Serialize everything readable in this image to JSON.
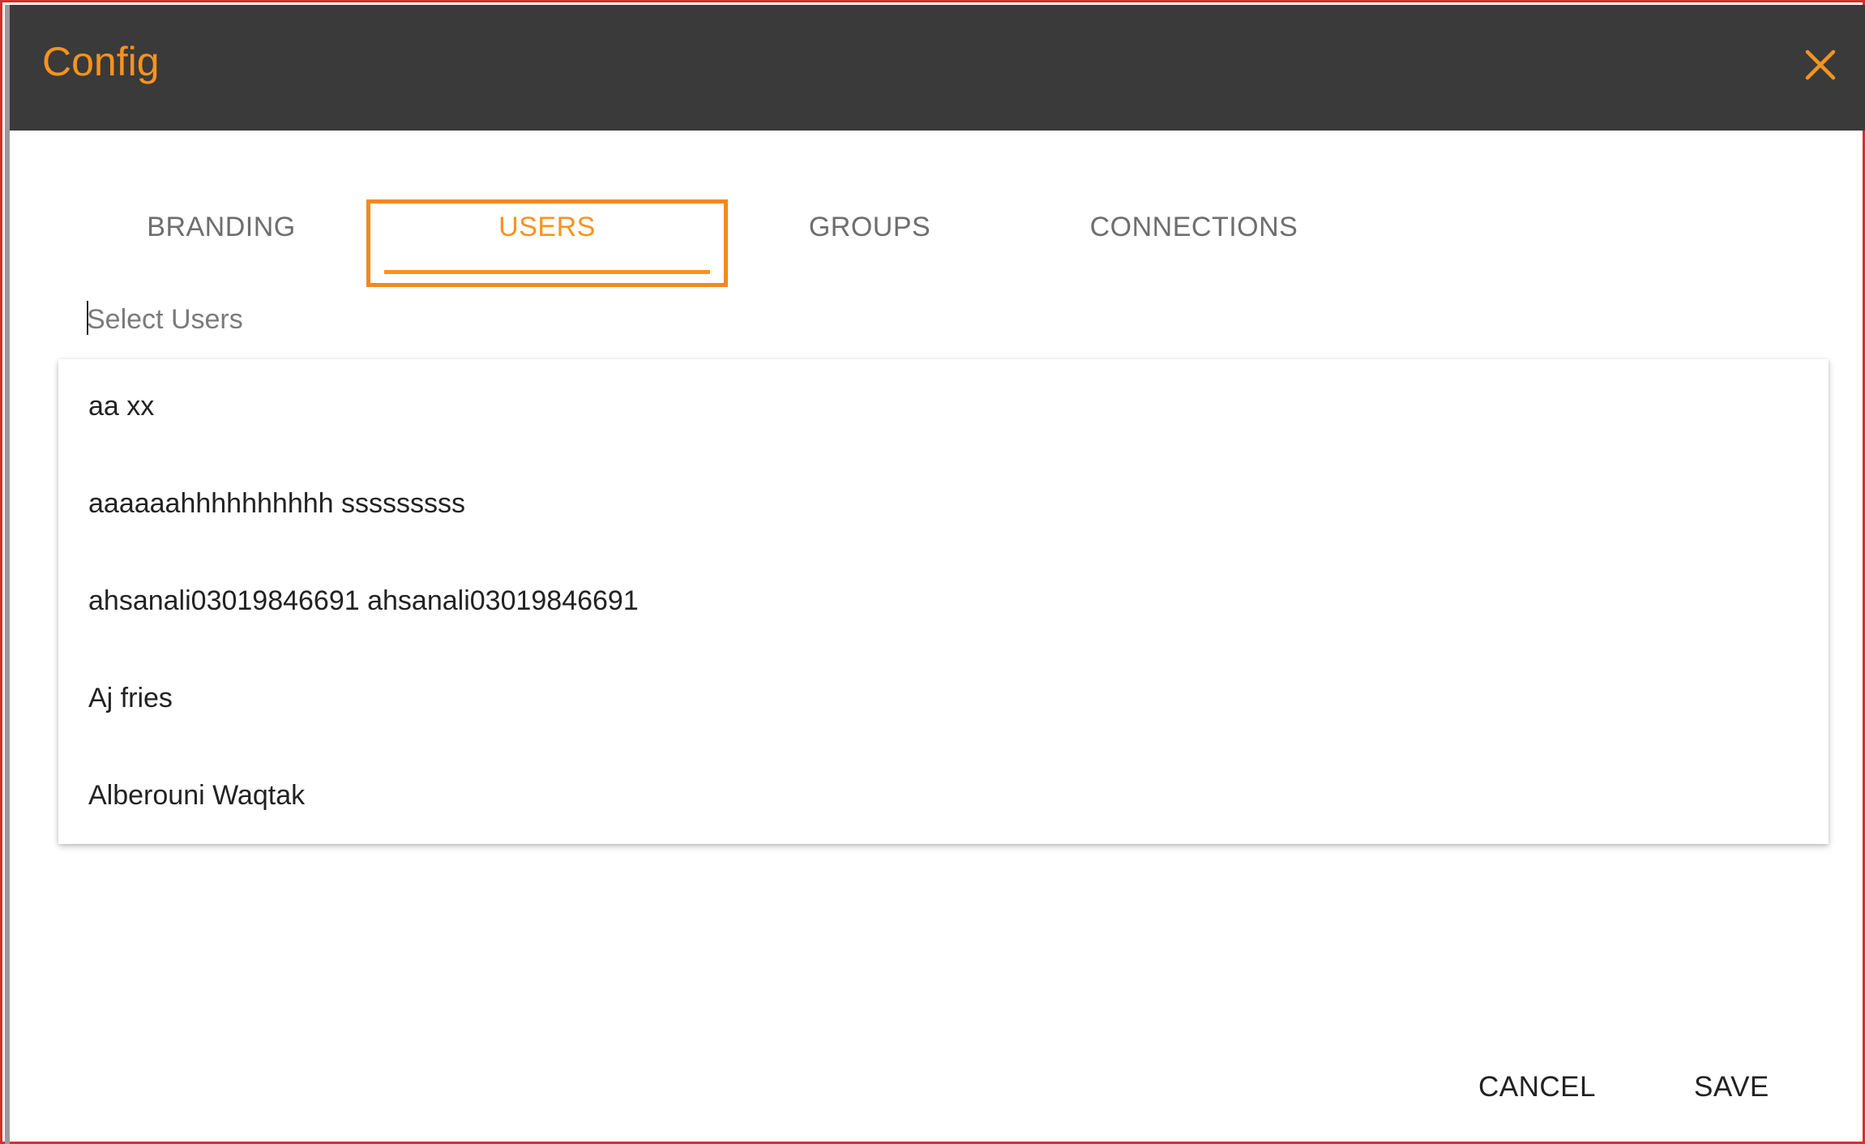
{
  "dialog": {
    "title": "Config"
  },
  "tabs": [
    {
      "label": "BRANDING",
      "active": false
    },
    {
      "label": "USERS",
      "active": true
    },
    {
      "label": "GROUPS",
      "active": false
    },
    {
      "label": "CONNECTIONS",
      "active": false
    }
  ],
  "users": {
    "select_placeholder": "Select Users",
    "select_value": "",
    "options": [
      {
        "label": "aa xx"
      },
      {
        "label": "aaaaaahhhhhhhhhh sssssssss"
      },
      {
        "label": "ahsanali03019846691 ahsanali03019846691"
      },
      {
        "label": "Aj fries"
      },
      {
        "label": "Alberouni Waqtak"
      }
    ]
  },
  "footer": {
    "cancel_label": "CANCEL",
    "save_label": "SAVE"
  },
  "colors": {
    "accent": "#f7931e",
    "titlebar_bg": "#3a3a3a",
    "highlight_border": "#f7871f",
    "frame_border": "#d0312d"
  },
  "icons": {
    "close": "close-icon"
  }
}
